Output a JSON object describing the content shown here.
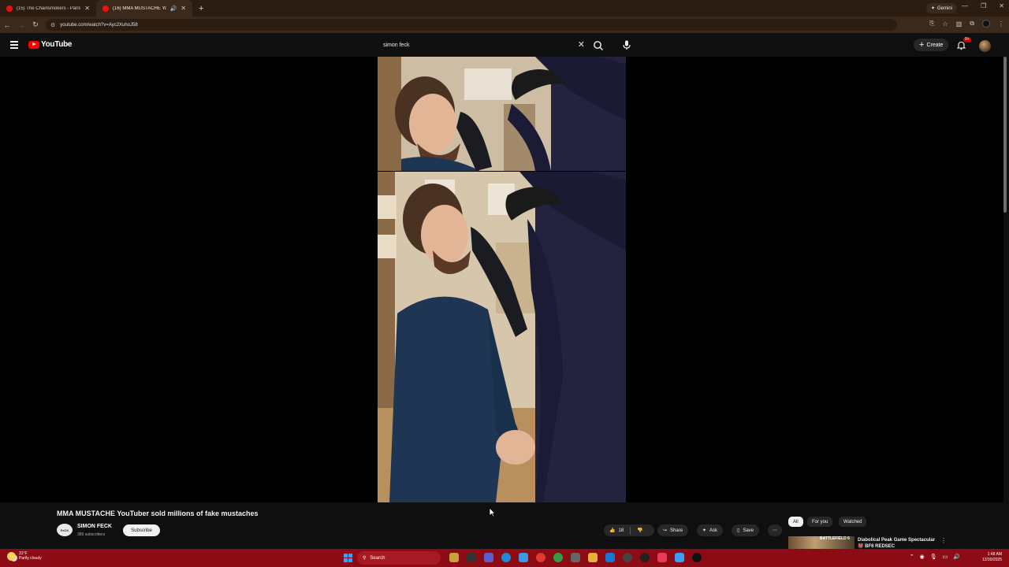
{
  "browser": {
    "tabs": [
      {
        "title": "(15) The Chainsmokers - Paris (",
        "active": false
      },
      {
        "title": "(16) MMA MUSTACHE YouTu",
        "active": true
      }
    ],
    "new_tab_glyph": "+",
    "gemini_label": "Gemini",
    "url": "youtube.com/watch?v=Ayc2XuhoJ58",
    "window_controls": [
      "—",
      "❐",
      "✕"
    ]
  },
  "youtube": {
    "logo_text": "YouTube",
    "search_value": "simon feck",
    "create_label": "Create",
    "notification_badge": "9+"
  },
  "video": {
    "title": "MMA MUSTACHE YouTuber sold millions of fake mustaches",
    "channel_name": "SIMON FECK",
    "channel_avatar_text": "FeCK",
    "subscribers": "389 subscribers",
    "subscribe_label": "Subscribe",
    "like_count": "18",
    "share_label": "Share",
    "ask_label": "Ask",
    "save_label": "Save"
  },
  "sidebar_chips": [
    {
      "label": "All",
      "selected": true
    },
    {
      "label": "For you",
      "selected": false
    },
    {
      "label": "Watched",
      "selected": false
    }
  ],
  "recommendation": {
    "thumb_text": "BATTLEFIELD 6",
    "title": "Diabolical Peak Game Spectacular 👹 BF6 REDSEC"
  },
  "taskbar": {
    "weather_temp": "31°F",
    "weather_desc": "Partly cloudy",
    "search_label": "Search",
    "time": "1:48 AM",
    "date": "12/30/2025"
  },
  "colors": {
    "youtube_red": "#ff0000",
    "taskbar": "#8c0b14",
    "browser_chrome": "#3b2a1c"
  }
}
